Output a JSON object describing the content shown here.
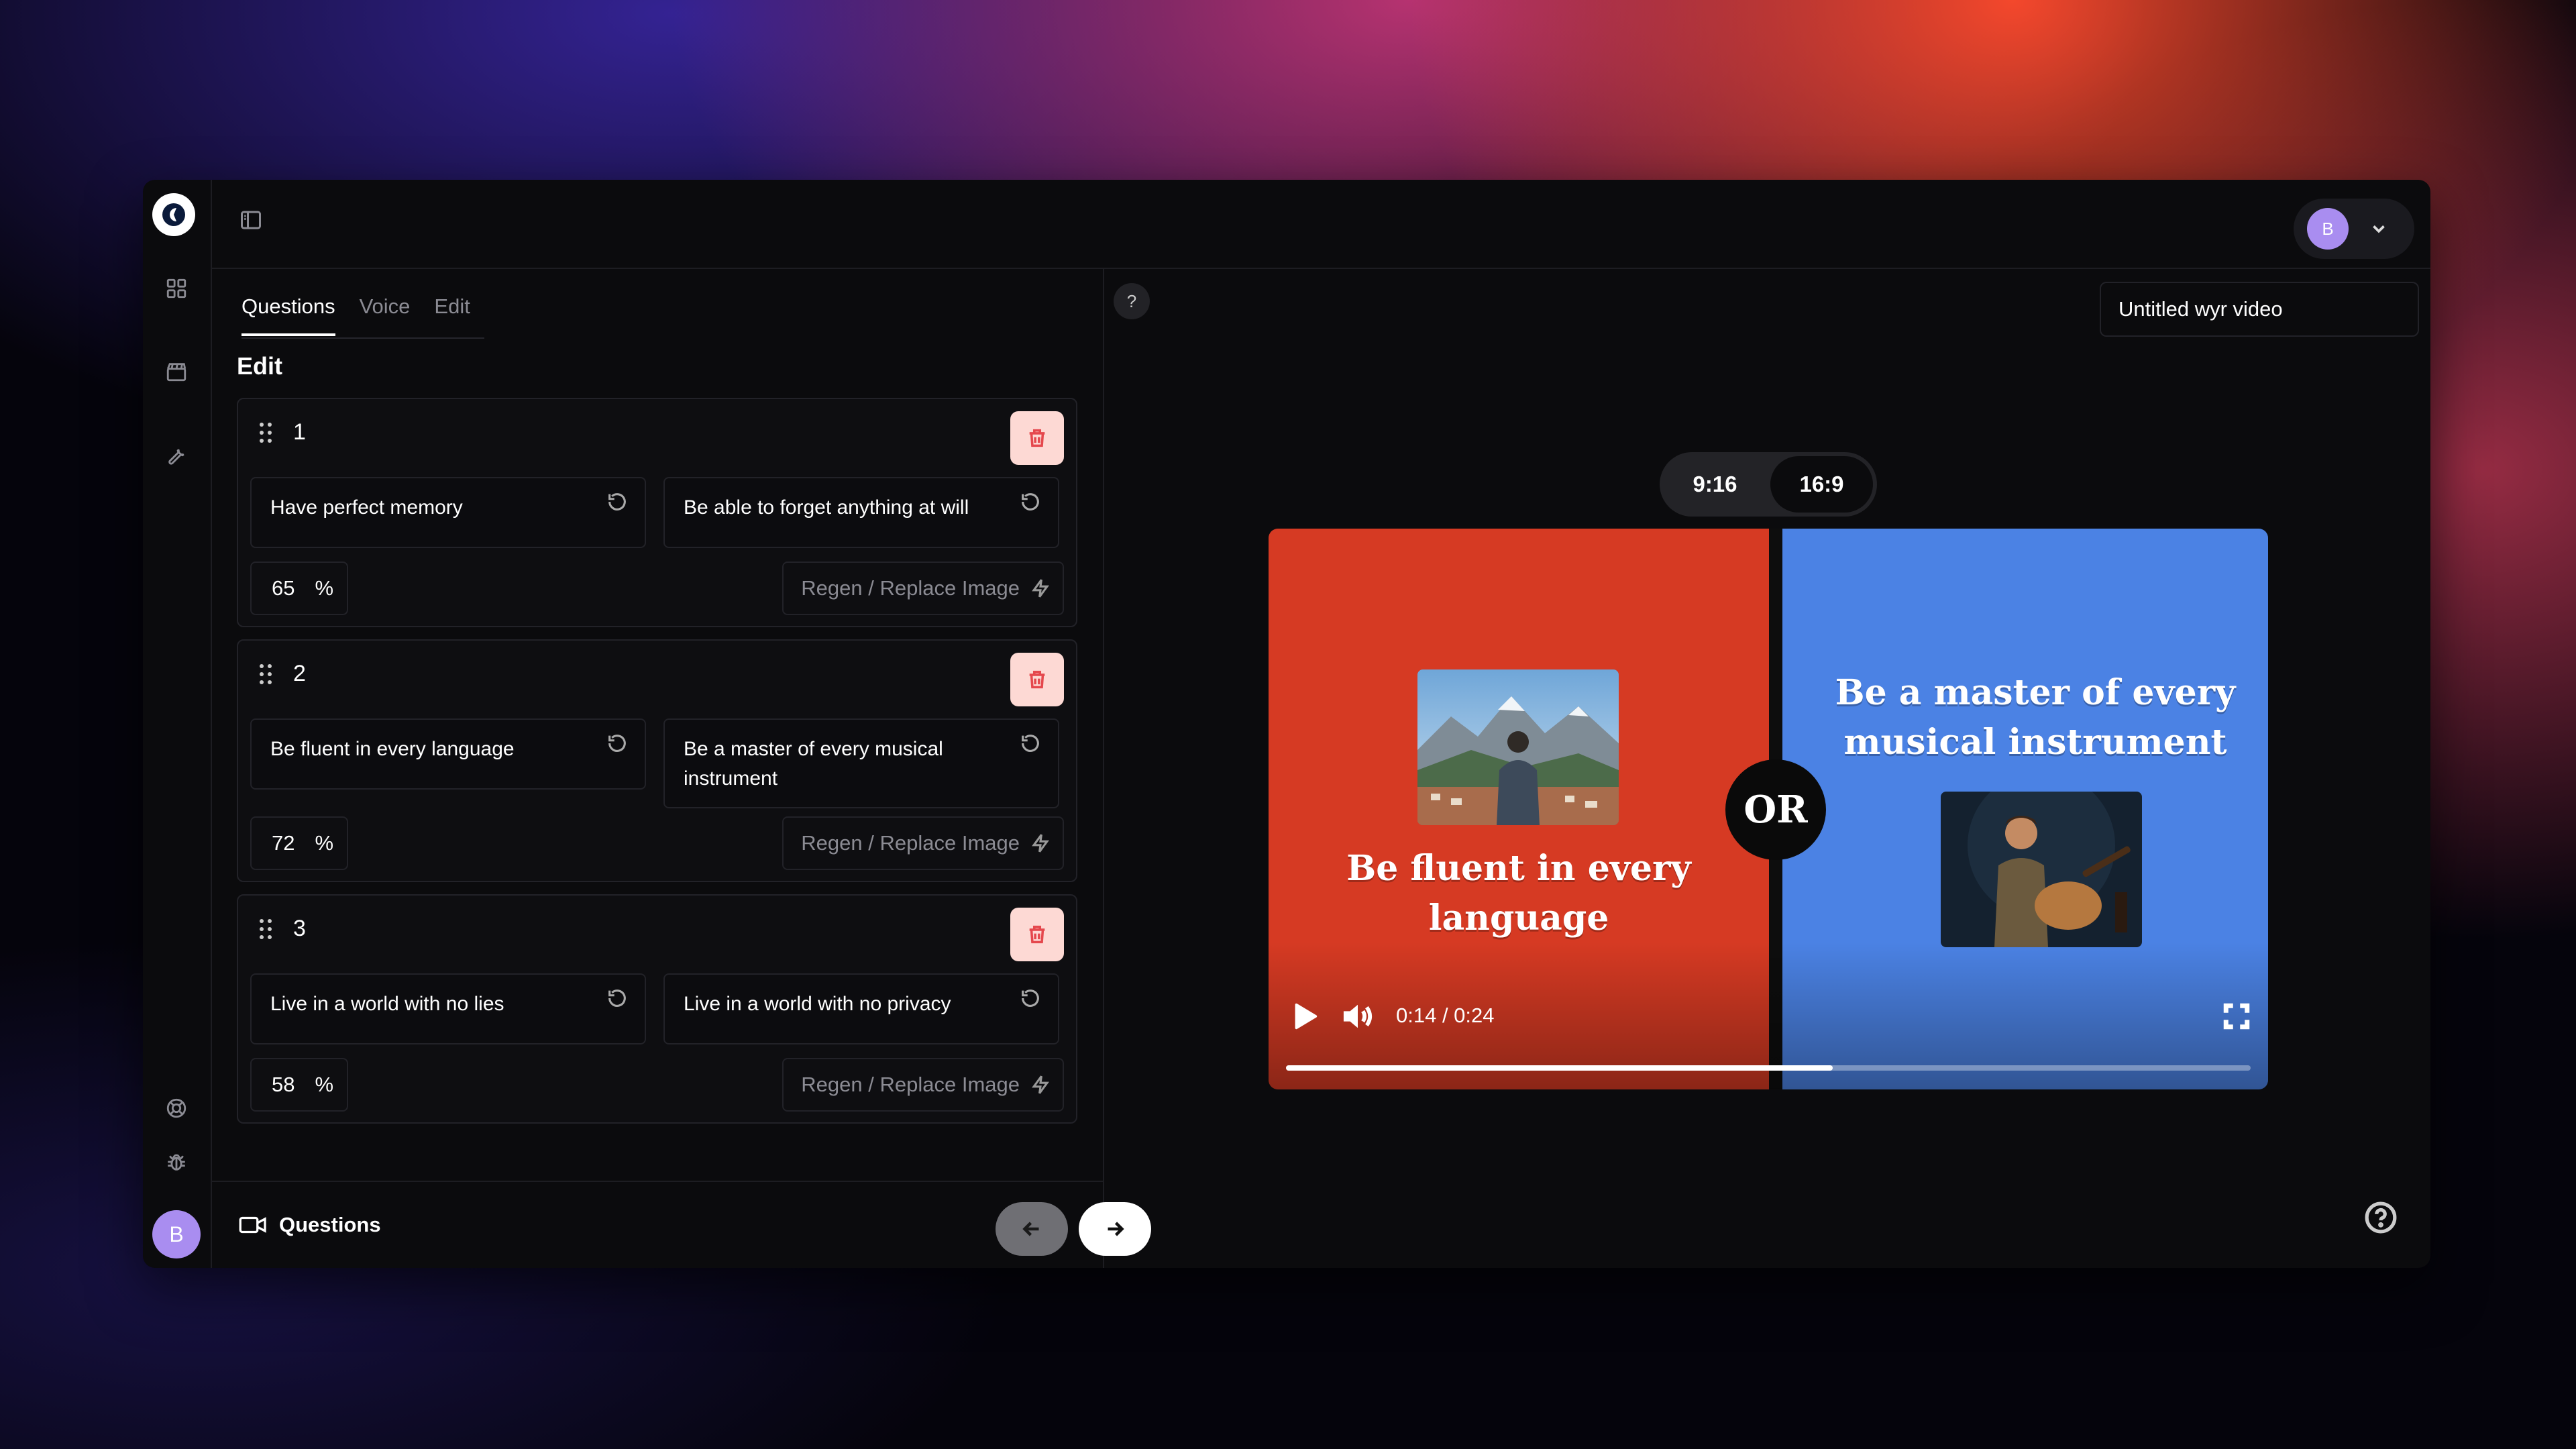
{
  "sidebar": {
    "avatar_initial": "B",
    "items": [
      {
        "name": "grid-icon"
      },
      {
        "name": "clapperboard-icon"
      },
      {
        "name": "wrench-icon"
      },
      {
        "name": "lifebuoy-icon"
      },
      {
        "name": "bug-icon"
      }
    ]
  },
  "header": {
    "user_initial": "B",
    "accent_color": "#a98df0"
  },
  "tabs": [
    {
      "label": "Questions",
      "active": true
    },
    {
      "label": "Voice",
      "active": false
    },
    {
      "label": "Edit",
      "active": false
    }
  ],
  "editor": {
    "title": "Edit",
    "questions": [
      {
        "number": "1",
        "option_a": "Have perfect memory",
        "option_b": "Be able to forget anything at will",
        "percent": "65",
        "percent_unit": "%",
        "regen_label": "Regen / Replace Image"
      },
      {
        "number": "2",
        "option_a": "Be fluent in every language",
        "option_b": "Be a master of every musical instrument",
        "percent": "72",
        "percent_unit": "%",
        "regen_label": "Regen / Replace Image"
      },
      {
        "number": "3",
        "option_a": "Live in a world with no lies",
        "option_b": "Live in a world with no privacy",
        "percent": "58",
        "percent_unit": "%",
        "regen_label": "Regen / Replace Image"
      }
    ]
  },
  "footer": {
    "step_label": "Questions"
  },
  "preview": {
    "help_label": "?",
    "video_title": "Untitled wyr video",
    "aspect_options": [
      {
        "label": "9:16",
        "selected": false
      },
      {
        "label": "16:9",
        "selected": true
      }
    ],
    "left_text": "Be fluent in every language",
    "right_text": "Be a master of every musical instrument",
    "or_label": "OR",
    "left_color": "#d63a23",
    "right_color": "#4b82e4",
    "time": "0:14 / 0:24",
    "progress_fraction": 0.567
  }
}
